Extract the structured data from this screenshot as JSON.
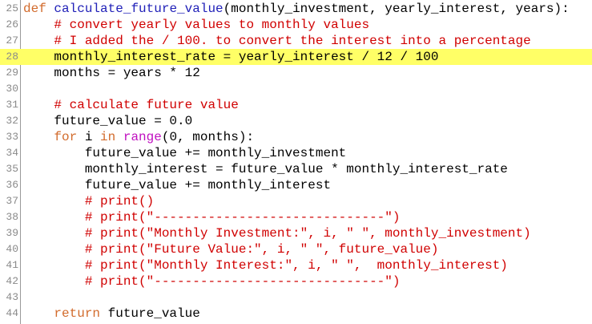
{
  "editor": {
    "language": "python",
    "highlighted_line": 28,
    "colors": {
      "keyword": "#d26b2c",
      "builtin": "#c010c0",
      "function_name": "#2020b8",
      "comment": "#d00000",
      "text": "#000000",
      "line_number": "#8a8a8a",
      "highlight": "#ffff66"
    },
    "lines": [
      {
        "n": "25",
        "tokens": [
          {
            "t": "kw",
            "s": "def"
          },
          {
            "t": "tx",
            "s": " "
          },
          {
            "t": "fn",
            "s": "calculate_future_value"
          },
          {
            "t": "tx",
            "s": "(monthly_investment, yearly_interest, years):"
          }
        ]
      },
      {
        "n": "26",
        "tokens": [
          {
            "t": "tx",
            "s": "    "
          },
          {
            "t": "cm",
            "s": "# convert yearly values to monthly values"
          }
        ]
      },
      {
        "n": "27",
        "tokens": [
          {
            "t": "tx",
            "s": "    "
          },
          {
            "t": "cm",
            "s": "# I added the / 100. to convert the interest into a percentage"
          }
        ]
      },
      {
        "n": "28",
        "tokens": [
          {
            "t": "tx",
            "s": "    monthly_interest_rate = yearly_interest / 12 / 100"
          }
        ]
      },
      {
        "n": "29",
        "tokens": [
          {
            "t": "tx",
            "s": "    months = years * 12"
          }
        ]
      },
      {
        "n": "30",
        "tokens": [
          {
            "t": "tx",
            "s": ""
          }
        ]
      },
      {
        "n": "31",
        "tokens": [
          {
            "t": "tx",
            "s": "    "
          },
          {
            "t": "cm",
            "s": "# calculate future value"
          }
        ]
      },
      {
        "n": "32",
        "tokens": [
          {
            "t": "tx",
            "s": "    future_value = 0.0"
          }
        ]
      },
      {
        "n": "33",
        "tokens": [
          {
            "t": "tx",
            "s": "    "
          },
          {
            "t": "kw",
            "s": "for"
          },
          {
            "t": "tx",
            "s": " i "
          },
          {
            "t": "kw",
            "s": "in"
          },
          {
            "t": "tx",
            "s": " "
          },
          {
            "t": "bi",
            "s": "range"
          },
          {
            "t": "tx",
            "s": "(0, months):"
          }
        ]
      },
      {
        "n": "34",
        "tokens": [
          {
            "t": "tx",
            "s": "        future_value += monthly_investment"
          }
        ]
      },
      {
        "n": "35",
        "tokens": [
          {
            "t": "tx",
            "s": "        monthly_interest = future_value * monthly_interest_rate"
          }
        ]
      },
      {
        "n": "36",
        "tokens": [
          {
            "t": "tx",
            "s": "        future_value += monthly_interest"
          }
        ]
      },
      {
        "n": "37",
        "tokens": [
          {
            "t": "tx",
            "s": "        "
          },
          {
            "t": "cm",
            "s": "# print()"
          }
        ]
      },
      {
        "n": "38",
        "tokens": [
          {
            "t": "tx",
            "s": "        "
          },
          {
            "t": "cm",
            "s": "# print(\"------------------------------\")"
          }
        ]
      },
      {
        "n": "39",
        "tokens": [
          {
            "t": "tx",
            "s": "        "
          },
          {
            "t": "cm",
            "s": "# print(\"Monthly Investment:\", i, \" \", monthly_investment)"
          }
        ]
      },
      {
        "n": "40",
        "tokens": [
          {
            "t": "tx",
            "s": "        "
          },
          {
            "t": "cm",
            "s": "# print(\"Future Value:\", i, \" \", future_value)"
          }
        ]
      },
      {
        "n": "41",
        "tokens": [
          {
            "t": "tx",
            "s": "        "
          },
          {
            "t": "cm",
            "s": "# print(\"Monthly Interest:\", i, \" \",  monthly_interest)"
          }
        ]
      },
      {
        "n": "42",
        "tokens": [
          {
            "t": "tx",
            "s": "        "
          },
          {
            "t": "cm",
            "s": "# print(\"------------------------------\")"
          }
        ]
      },
      {
        "n": "43",
        "tokens": [
          {
            "t": "tx",
            "s": ""
          }
        ]
      },
      {
        "n": "44",
        "tokens": [
          {
            "t": "tx",
            "s": "    "
          },
          {
            "t": "kw",
            "s": "return"
          },
          {
            "t": "tx",
            "s": " future_value"
          }
        ]
      }
    ]
  }
}
